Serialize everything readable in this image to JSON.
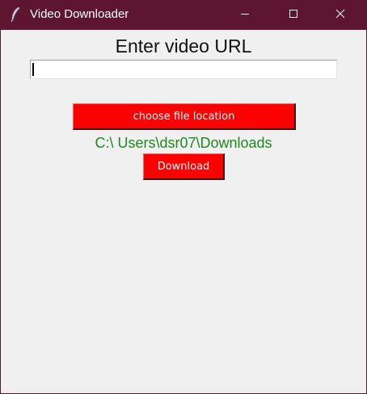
{
  "window": {
    "title": "Video Downloader",
    "icon": "feather-icon"
  },
  "titlebar_buttons": {
    "minimize": "minimize-icon",
    "maximize": "maximize-icon",
    "close": "close-icon"
  },
  "main": {
    "heading": "Enter video URL",
    "url_value": "",
    "choose_location_label": "choose file location",
    "download_path": "C:\\ Users\\dsr07\\Downloads",
    "download_label": "Download"
  },
  "colors": {
    "titlebar": "#5e1530",
    "button": "#ff0000",
    "path_text": "#1e8a1e",
    "background": "#f0f0f0"
  }
}
